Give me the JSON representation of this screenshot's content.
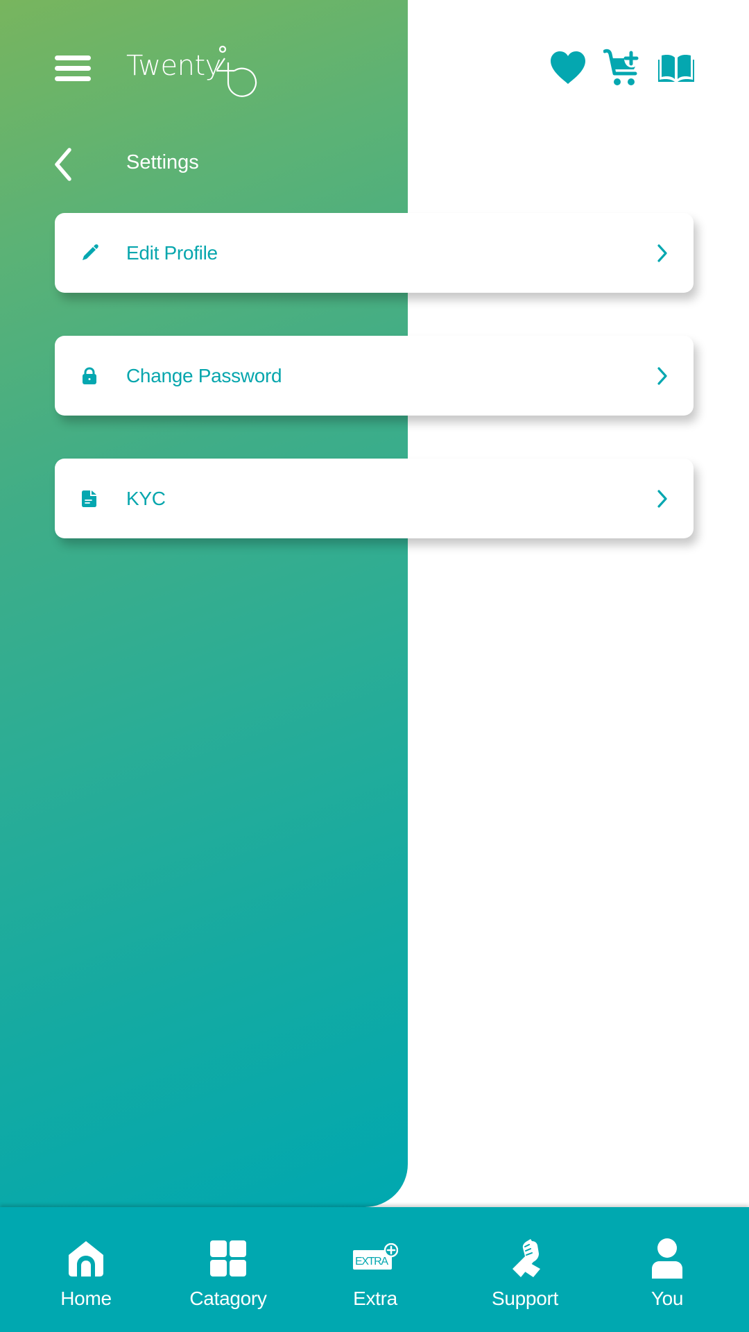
{
  "app": {
    "logo_text": "Twenty",
    "logo_suffix": "40"
  },
  "header": {
    "menu_icon": "hamburger-icon",
    "back_icon": "chevron-left-icon",
    "title": "Settings",
    "actions": [
      {
        "name": "favorites",
        "icon": "heart-icon"
      },
      {
        "name": "add-to-cart",
        "icon": "cart-plus-icon"
      },
      {
        "name": "catalog",
        "icon": "open-book-icon"
      }
    ]
  },
  "settings": {
    "items": [
      {
        "label": "Edit Profile",
        "icon": "pencil-icon"
      },
      {
        "label": "Change Password",
        "icon": "lock-icon"
      },
      {
        "label": "KYC",
        "icon": "document-icon"
      }
    ]
  },
  "bottom_nav": {
    "items": [
      {
        "label": "Home",
        "icon": "home-icon"
      },
      {
        "label": "Catagory",
        "icon": "grid-icon"
      },
      {
        "label": "Extra",
        "icon": "extra-badge-icon",
        "badge_text": "EXTRA"
      },
      {
        "label": "Support",
        "icon": "handshake-icon"
      },
      {
        "label": "You",
        "icon": "user-icon"
      }
    ]
  },
  "colors": {
    "accent": "#04a7b0",
    "gradient_start": "#78b55e",
    "gradient_end": "#00a8b0",
    "nav_background": "#00a8b0",
    "card_background": "#ffffff"
  }
}
